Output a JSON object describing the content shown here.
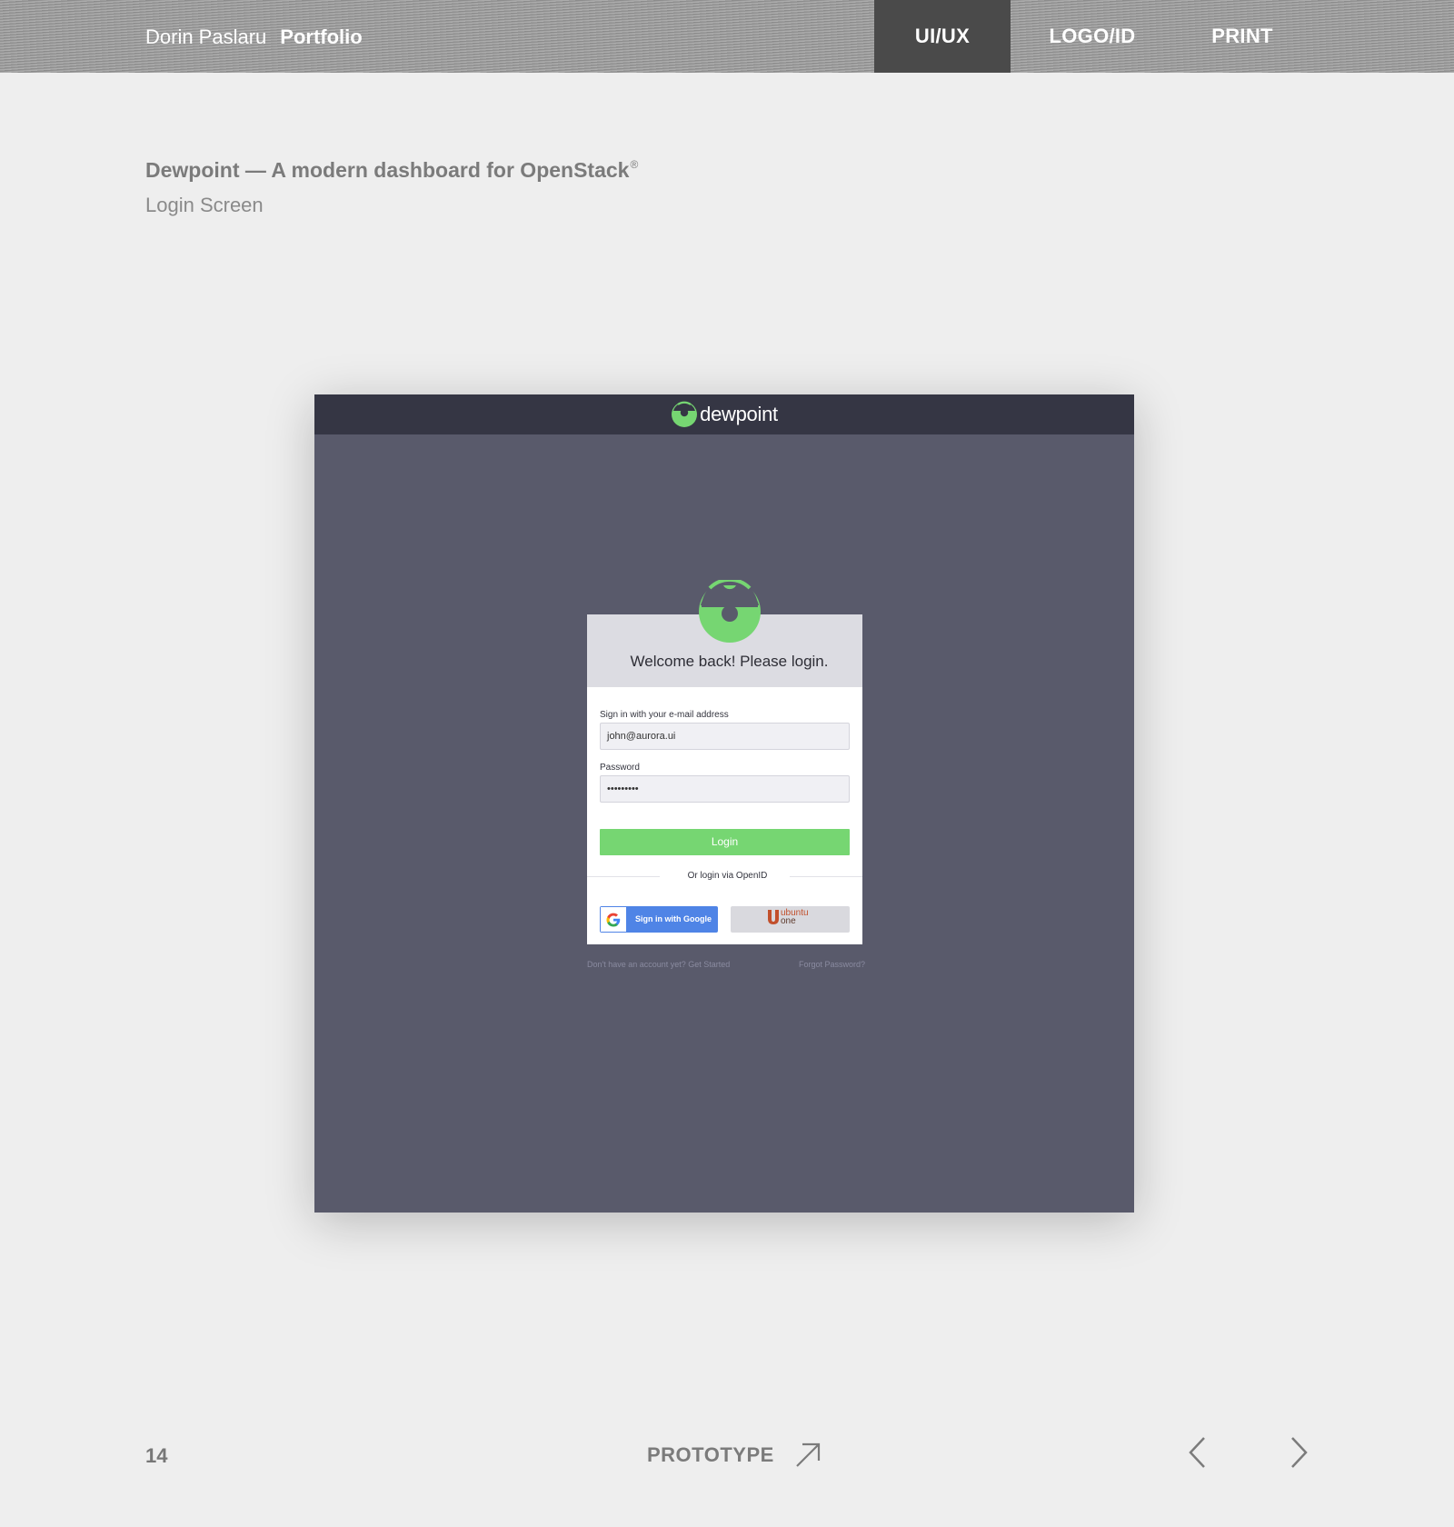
{
  "header": {
    "author": "Dorin Paslaru",
    "portfolio": "Portfolio",
    "nav": [
      {
        "label": "UI/UX",
        "active": true
      },
      {
        "label": "LOGO/ID",
        "active": false
      },
      {
        "label": "PRINT",
        "active": false
      }
    ]
  },
  "project": {
    "title": "Dewpoint — A modern dashboard for OpenStack",
    "title_mark": "®",
    "subtitle": "Login Screen"
  },
  "mockup": {
    "logo_text": "dewpoint",
    "welcome": "Welcome back! Please login.",
    "email_label": "Sign in with your e-mail address",
    "email_value": "john@aurora.ui",
    "password_label": "Password",
    "password_value": "•••••••••",
    "login_button": "Login",
    "openid_divider": "Or login via OpenID",
    "google_button": "Sign in with Google",
    "ubuntu_line1": "ubuntu",
    "ubuntu_line2": "one",
    "signup_link": "Don't have an account yet? Get Started",
    "forgot_link": "Forgot Password?",
    "colors": {
      "brand_green": "#76d672",
      "frame_bg": "#595a6b",
      "topbar_bg": "#353644",
      "google_blue": "#4f84e6",
      "ubuntu_orange": "#c2502c"
    }
  },
  "footer": {
    "page_number": "14",
    "prototype_label": "PROTOTYPE",
    "icons": [
      "arrow-up-right-icon",
      "chevron-left-icon",
      "chevron-right-icon"
    ]
  }
}
